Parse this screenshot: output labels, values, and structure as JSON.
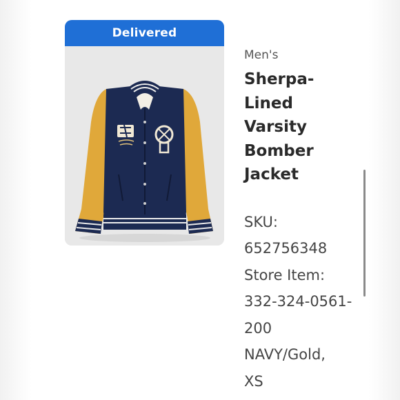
{
  "status_badge": "Delivered",
  "product": {
    "category": "Men's",
    "title_lines": [
      "Sherpa-",
      "Lined",
      "Varsity",
      "Bomber",
      "Jacket"
    ],
    "detail_lines": [
      "SKU:",
      "652756348",
      "Store Item:",
      "332-324-0561-",
      "200",
      "NAVY/Gold,",
      "XS"
    ]
  },
  "colors": {
    "badge": "#1f6fd6",
    "jacket_body": "#1c2a52",
    "jacket_sleeves": "#e0a83a"
  }
}
